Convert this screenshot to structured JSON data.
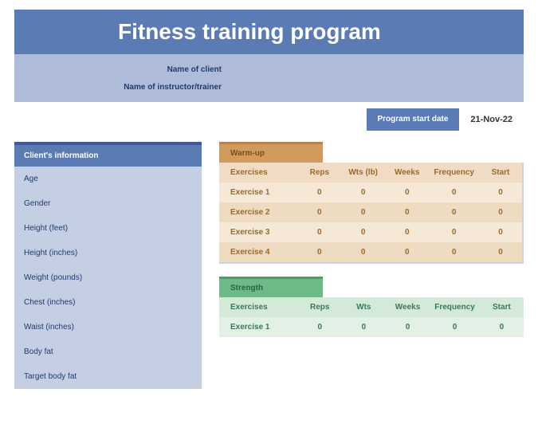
{
  "header": {
    "title": "Fitness training program",
    "client_label": "Name of client",
    "trainer_label": "Name of instructor/trainer"
  },
  "program_start": {
    "label": "Program start date",
    "value": "21-Nov-22"
  },
  "client_info": {
    "header": "Client's information",
    "rows": [
      "Age",
      "Gender",
      "Height (feet)",
      "Height (inches)",
      "Weight (pounds)",
      "Chest (inches)",
      "Waist (inches)",
      "Body fat",
      "Target body fat"
    ]
  },
  "warmup": {
    "title": "Warm-up",
    "columns": [
      "Exercises",
      "Reps",
      "Wts (lb)",
      "Weeks",
      "Frequency",
      "Start"
    ],
    "rows": [
      {
        "name": "Exercise 1",
        "vals": [
          "0",
          "0",
          "0",
          "0",
          "0"
        ]
      },
      {
        "name": "Exercise 2",
        "vals": [
          "0",
          "0",
          "0",
          "0",
          "0"
        ]
      },
      {
        "name": "Exercise 3",
        "vals": [
          "0",
          "0",
          "0",
          "0",
          "0"
        ]
      },
      {
        "name": "Exercise 4",
        "vals": [
          "0",
          "0",
          "0",
          "0",
          "0"
        ]
      }
    ]
  },
  "strength": {
    "title": "Strength",
    "columns": [
      "Exercises",
      "Reps",
      "Wts",
      "Weeks",
      "Frequency",
      "Start"
    ],
    "rows": [
      {
        "name": "Exercise 1",
        "vals": [
          "0",
          "0",
          "0",
          "0",
          "0"
        ]
      }
    ]
  }
}
